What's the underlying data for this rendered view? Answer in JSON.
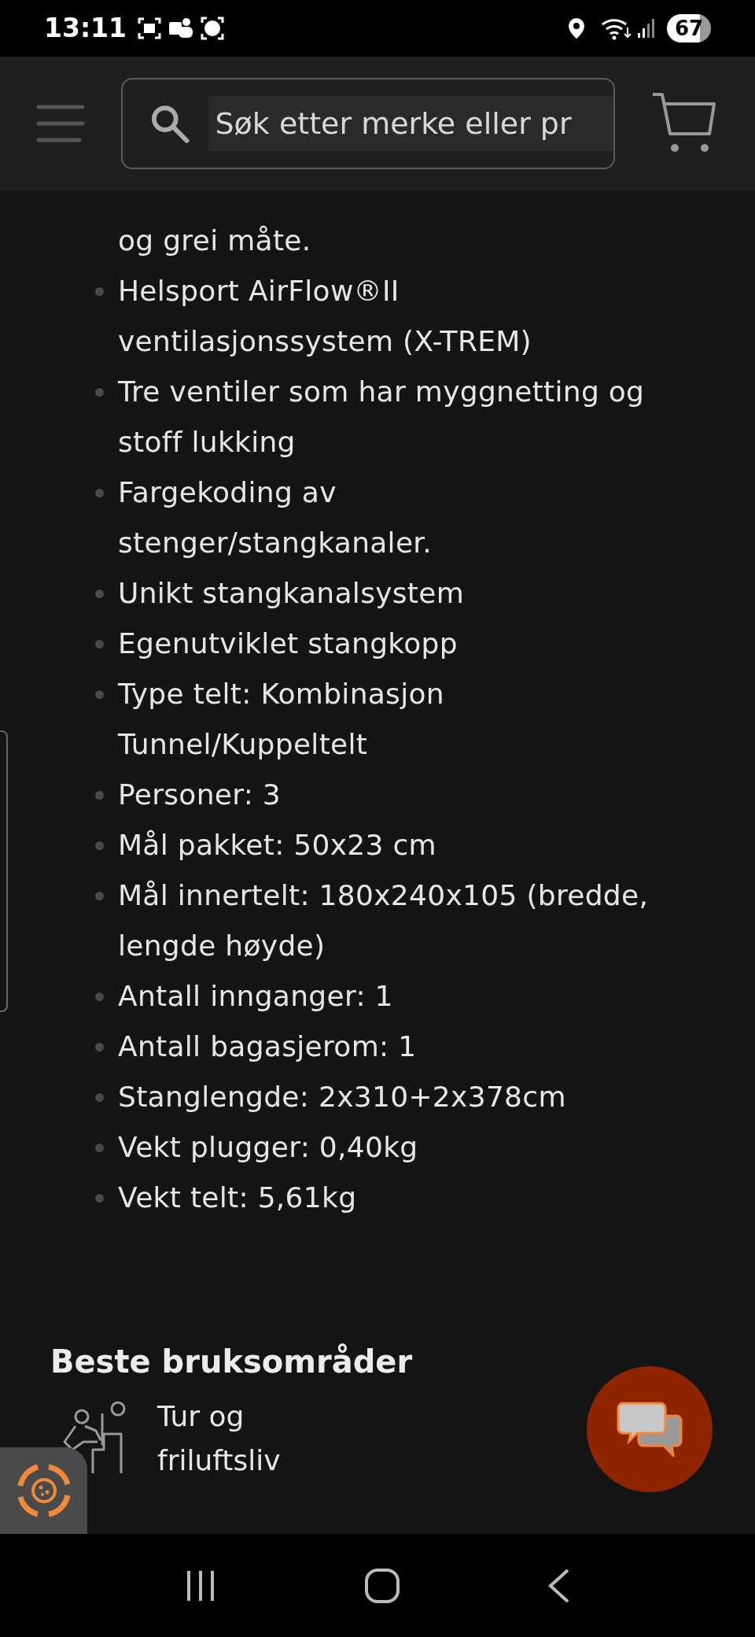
{
  "status_bar": {
    "time": "13:11",
    "battery": "67"
  },
  "search": {
    "placeholder": "Søk etter merke eller pr"
  },
  "features": [
    {
      "continued": true,
      "lines": [
        "og grei måte."
      ]
    },
    {
      "continued": false,
      "lines": [
        "Helsport AirFlow®II",
        "ventilasjonssystem (X-TREM)"
      ]
    },
    {
      "continued": false,
      "lines": [
        "Tre ventiler som har myggnetting og",
        "stoff lukking"
      ]
    },
    {
      "continued": false,
      "lines": [
        "Fargekoding av",
        "stenger/stangkanaler."
      ]
    },
    {
      "continued": false,
      "lines": [
        "Unikt stangkanalsystem"
      ]
    },
    {
      "continued": false,
      "lines": [
        "Egenutviklet stangkopp"
      ]
    },
    {
      "continued": false,
      "lines": [
        "Type telt: Kombinasjon",
        "Tunnel/Kuppeltelt"
      ]
    },
    {
      "continued": false,
      "lines": [
        "Personer: 3"
      ]
    },
    {
      "continued": false,
      "lines": [
        "Mål pakket: 50x23 cm"
      ]
    },
    {
      "continued": false,
      "lines": [
        "Mål innertelt: 180x240x105 (bredde,",
        "lengde høyde)"
      ]
    },
    {
      "continued": false,
      "lines": [
        "Antall innganger: 1"
      ]
    },
    {
      "continued": false,
      "lines": [
        "Antall bagasjerom: 1"
      ]
    },
    {
      "continued": false,
      "lines": [
        "Stanglengde: 2x310+2x378cm"
      ]
    },
    {
      "continued": false,
      "lines": [
        "Vekt plugger: 0,40kg"
      ]
    },
    {
      "continued": false,
      "lines": [
        "Vekt telt: 5,61kg"
      ]
    }
  ],
  "usage": {
    "title": "Beste bruksområder",
    "items": [
      {
        "lines": [
          "Tur og",
          "friluftsliv"
        ]
      }
    ]
  }
}
